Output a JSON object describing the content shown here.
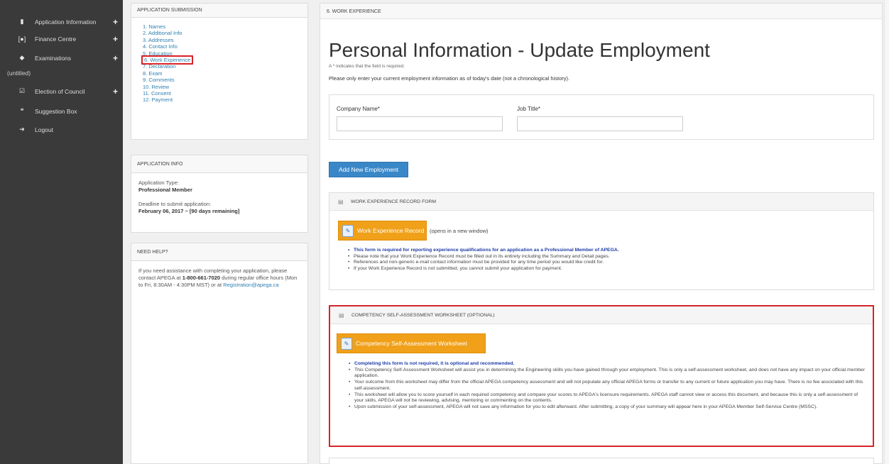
{
  "sidebar": {
    "items": [
      {
        "label": "Application Information",
        "icon": "book-icon"
      },
      {
        "label": "Finance Centre",
        "icon": "money-icon"
      },
      {
        "label": "Examinations",
        "icon": "compass-icon"
      },
      {
        "label": "Election of Council",
        "icon": "checkbox-icon"
      },
      {
        "label": "Suggestion Box",
        "icon": "comments-icon"
      },
      {
        "label": "Logout",
        "icon": "logout-icon"
      }
    ],
    "untitled": "(untitled)",
    "plus": "+"
  },
  "submission": {
    "header": "APPLICATION SUBMISSION",
    "steps": [
      "1. Names",
      "2. Additional Info",
      "3. Addresses",
      "4. Contact Info",
      "5. Education",
      "6. Work Experience",
      "7. Declaration",
      "8. Exam",
      "9. Comments",
      "10. Review",
      "11. Consent",
      "12. Payment"
    ],
    "active_index": 5
  },
  "app_info": {
    "header": "APPLICATION INFO",
    "type_label": "Application Type:",
    "type_value": "Professional Member",
    "deadline_label": "Deadline to submit application:",
    "deadline_value": "February 06, 2017 ~ [90 days remaining]"
  },
  "help": {
    "header": "NEED HELP?",
    "text_1": "If you need assistance with completing your application, please contact APEGA at ",
    "phone": "1-800-661-7020",
    "text_2": " during regular office hours (Mon to Fri, 8:30AM - 4:30PM MST) or at ",
    "email": "Registration@apega.ca"
  },
  "main": {
    "section_header": "6. WORK EXPERIENCE",
    "title": "Personal Information - Update Employment",
    "required_note": "A * indicates that the field is required.",
    "instruction": "Please only enter your current employment information as of today's date (not a chronological history).",
    "company_label": "Company Name*",
    "job_label": "Job Title*",
    "company_value": "",
    "job_value": "",
    "add_button": "Add New Employment"
  },
  "work_record": {
    "header": "WORK EXPERIENCE RECORD FORM",
    "button": "Work Experience Record",
    "new_window": "(opens in a new window)",
    "bullets": [
      "This form is required for reporting experience qualifications for an application as a Professional Member of APEGA.",
      "Please note that your Work Experience Record must be filled out in its entirety including the Summary and Detail pages.",
      "References and non-generic e-mail contact information must be provided for any time period you would like credit for.",
      "If your Work Experience Record is not submitted, you cannot submit your application for payment."
    ]
  },
  "competency": {
    "header": "COMPETENCY SELF-ASSESSMENT WORKSHEET (OPTIONAL)",
    "button": "Competency Self-Assessment Worksheet",
    "bullets": [
      "Completing this form is not required, it is optional and recommended.",
      "This Competency Self-Assessment Worksheet will assist you in determining the Engineering skills you have gained through your employment.  This is only a self-assessment worksheet, and does not have any impact on your official member application.",
      "Your outcome from this worksheet may differ from the official APEGA competency assessment and will not populate any official APEGA forms or transfer to any current or future application you may have.  There is no fee associated with this self-assessment.",
      "This worksheet will allow you to score yourself in each required competency and compare your scores to APEGA's licensure requirements. APEGA staff cannot view or access this document, and because this is only a self-assessment of your skills, APEGA will not be reviewing, advising, mentoring or commenting on the contents.",
      "Upon submission of your self-assessment, APEGA will not save any information for you to edit afterward.  After submitting, a copy of your summary will appear here in your APEGA Member Self-Service Centre (MSSC)."
    ]
  },
  "colors": {
    "sidebar_bg": "#3a3a3a",
    "link": "#2f7fb0",
    "primary_button": "#3a87c8",
    "orange_button": "#f0a019",
    "highlight": "#d9232a"
  }
}
